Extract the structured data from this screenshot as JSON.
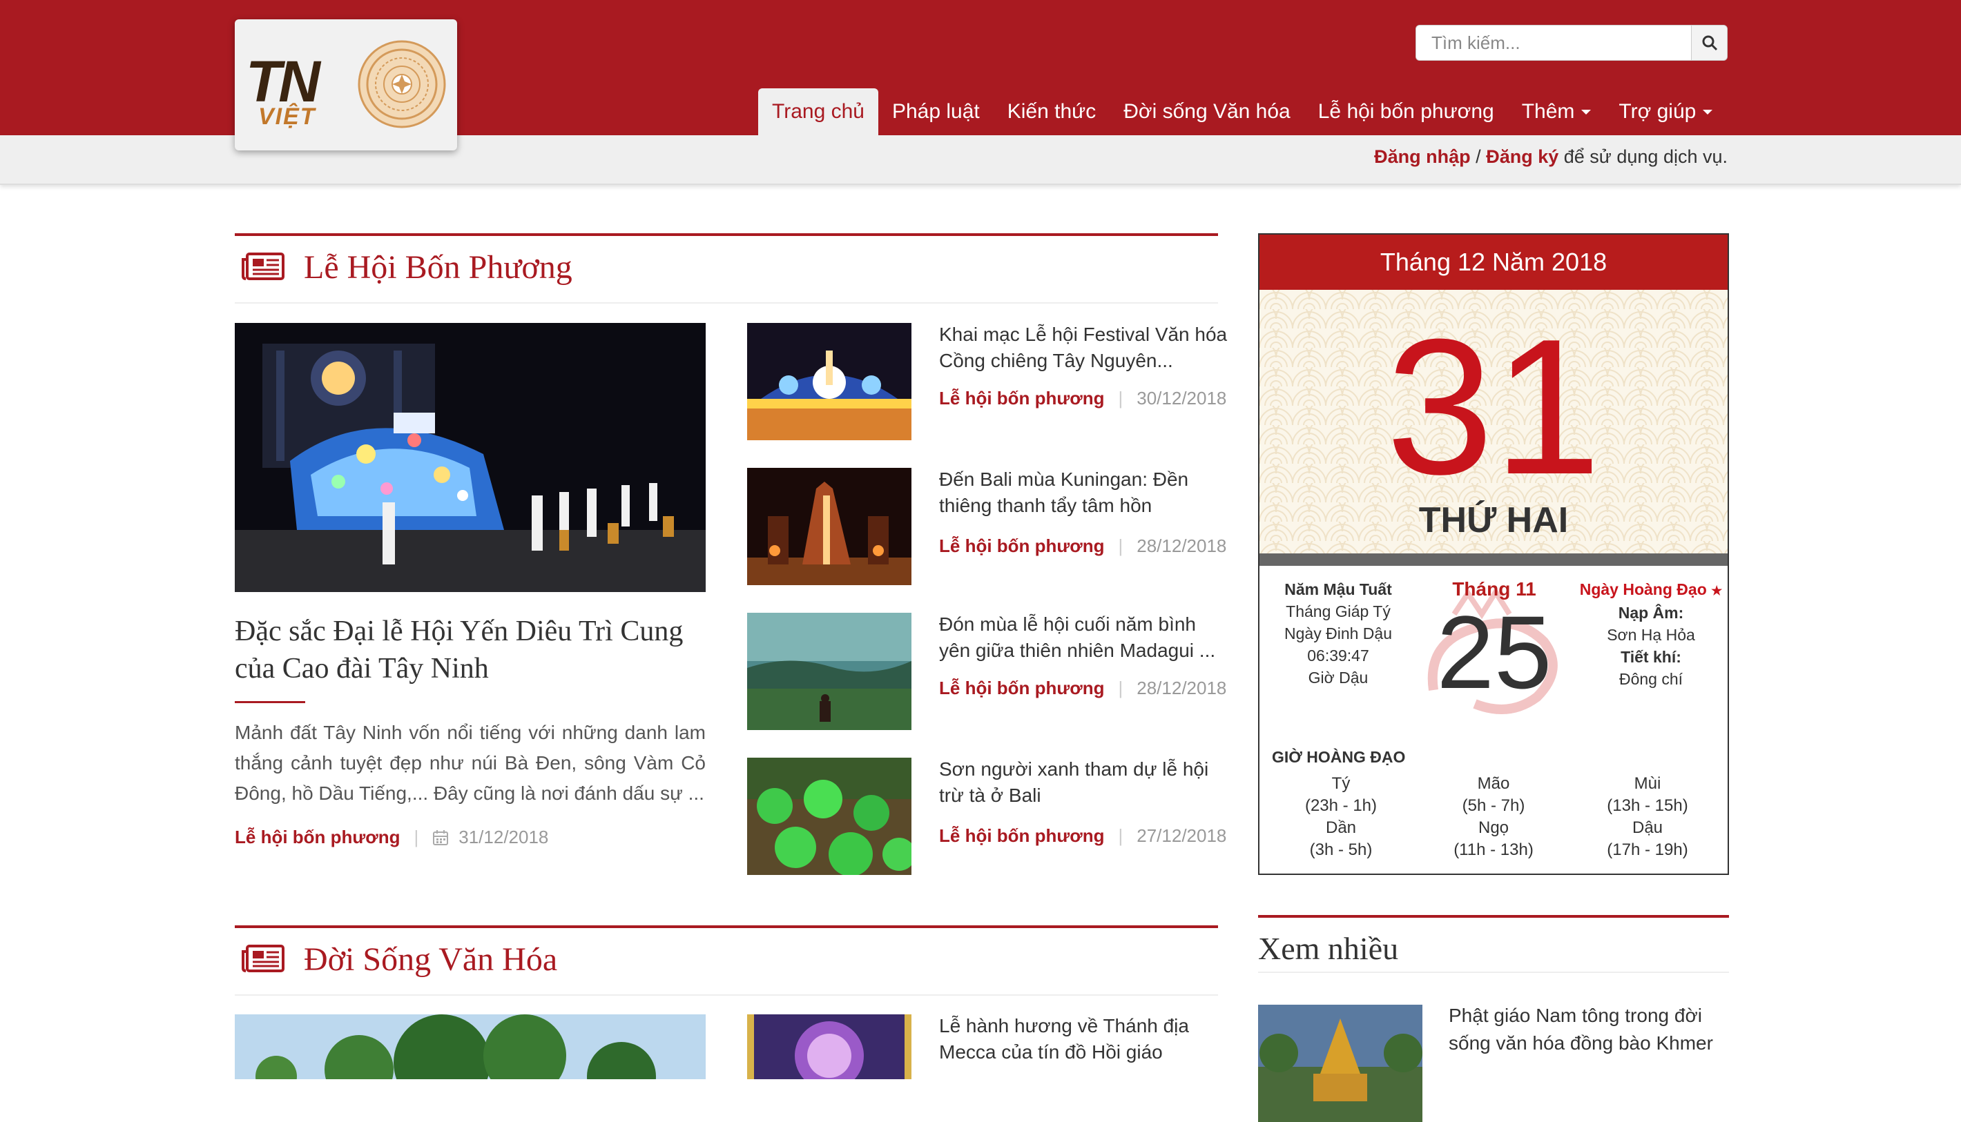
{
  "header": {
    "logo_text_tn": "TN",
    "logo_text_viet": "VIỆT",
    "search_placeholder": "Tìm kiếm...",
    "nav": [
      {
        "label": "Trang chủ",
        "active": true,
        "dropdown": false
      },
      {
        "label": "Pháp luật",
        "active": false,
        "dropdown": false
      },
      {
        "label": "Kiến thức",
        "active": false,
        "dropdown": false
      },
      {
        "label": "Đời sống Văn hóa",
        "active": false,
        "dropdown": false
      },
      {
        "label": "Lễ hội bốn phương",
        "active": false,
        "dropdown": false
      },
      {
        "label": "Thêm",
        "active": false,
        "dropdown": true
      },
      {
        "label": "Trợ giúp",
        "active": false,
        "dropdown": true
      }
    ],
    "login": {
      "login_label": "Đăng nhập",
      "slash": "/",
      "register_label": "Đăng ký",
      "suffix": "để sử dụng dịch vụ."
    }
  },
  "section1": {
    "title": "Lễ Hội Bốn Phương",
    "featured": {
      "title": "Đặc sắc Đại lễ Hội Yến Diêu Trì Cung của Cao đài Tây Ninh",
      "description": "Mảnh đất Tây Ninh vốn nổi tiếng với những danh lam thắng cảnh tuyệt đẹp như núi Bà Đen, sông Vàm Cỏ Đông, hồ Dầu Tiếng,... Đây cũng là nơi đánh dấu sự ...",
      "category": "Lễ hội bốn phương",
      "date": "31/12/2018"
    },
    "items": [
      {
        "title": "Khai mạc Lễ hội Festival Văn hóa Cồng chiêng Tây Nguyên...",
        "category": "Lễ hội bốn phương",
        "date": "30/12/2018"
      },
      {
        "title": "Đến Bali mùa Kuningan: Đền thiêng thanh tẩy tâm hồn",
        "category": "Lễ hội bốn phương",
        "date": "28/12/2018"
      },
      {
        "title": "Đón mùa lễ hội cuối năm bình yên giữa thiên nhiên Madagui ...",
        "category": "Lễ hội bốn phương",
        "date": "28/12/2018"
      },
      {
        "title": "Sơn người xanh tham dự lễ hội trừ tà ở Bali",
        "category": "Lễ hội bốn phương",
        "date": "27/12/2018"
      }
    ]
  },
  "section2": {
    "title": "Đời Sống Văn Hóa",
    "items": [
      {
        "title": "Lễ hành hương về Thánh địa Mecca của tín đồ Hồi giáo"
      }
    ]
  },
  "calendar": {
    "header": "Tháng 12 Năm 2018",
    "day": "31",
    "weekday": "THỨ HAI",
    "left": {
      "year": "Năm Mậu Tuất",
      "month": "Tháng Giáp Tý",
      "day": "Ngày Đinh Dậu",
      "time": "06:39:47",
      "hour": "Giờ Dậu"
    },
    "lunar_month": "Tháng 11",
    "lunar_day": "25",
    "right": {
      "good_day": "Ngày Hoàng Đạo",
      "star": "★",
      "napam_label": "Nạp Âm:",
      "napam_value": "Sơn Hạ Hỏa",
      "tietkhi_label": "Tiết khí:",
      "tietkhi_value": "Đông chí"
    },
    "good_hours_title": "GIỜ HOÀNG ĐẠO",
    "good_hours": [
      {
        "name": "Tý",
        "range": "(23h - 1h)"
      },
      {
        "name": "Mão",
        "range": "(5h - 7h)"
      },
      {
        "name": "Mùi",
        "range": "(13h - 15h)"
      },
      {
        "name": "Dần",
        "range": "(3h - 5h)"
      },
      {
        "name": "Ngọ",
        "range": "(11h - 13h)"
      },
      {
        "name": "Dậu",
        "range": "(17h - 19h)"
      }
    ],
    "colors": {
      "header": "#b71c1c",
      "day": "#c8141c"
    }
  },
  "sidebar": {
    "most_viewed_title": "Xem nhiều",
    "items": [
      {
        "title": "Phật giáo Nam tông trong đời sống văn hóa đồng bào Khmer"
      }
    ]
  },
  "colors": {
    "brand": "#a91a21",
    "background": "#ffffff",
    "subbar": "#efefef"
  }
}
